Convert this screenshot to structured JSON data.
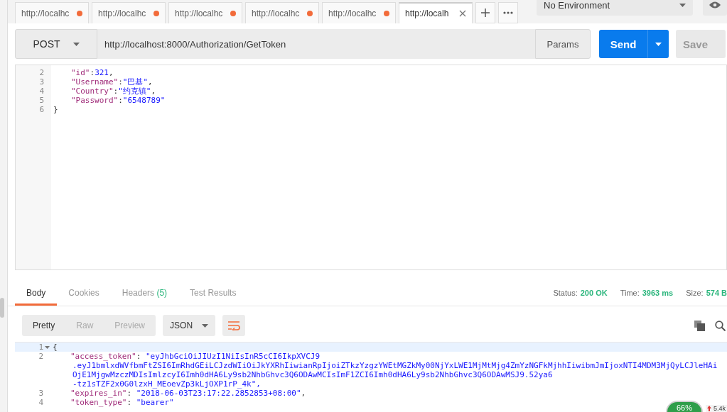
{
  "tabs": [
    {
      "label": "http://localhc",
      "selected": false,
      "unsaved": true
    },
    {
      "label": "http://localhc",
      "selected": false,
      "unsaved": true
    },
    {
      "label": "http://localhc",
      "selected": false,
      "unsaved": true
    },
    {
      "label": "http://localhc",
      "selected": false,
      "unsaved": true
    },
    {
      "label": "http://localhc",
      "selected": false,
      "unsaved": true
    },
    {
      "label": "http://localh",
      "selected": true,
      "unsaved": false
    }
  ],
  "environment": {
    "value": "No Environment"
  },
  "request": {
    "method": "POST",
    "url": "http://localhost:8000/Authorization/GetToken",
    "params_label": "Params",
    "send_label": "Send",
    "save_label": "Save"
  },
  "request_body": [
    {
      "number": "2",
      "segments": [
        {
          "kind": "key",
          "text": "\"id\""
        },
        {
          "kind": "punct",
          "text": ":"
        },
        {
          "kind": "number",
          "text": "321"
        },
        {
          "kind": "punct",
          "text": ","
        }
      ]
    },
    {
      "number": "3",
      "segments": [
        {
          "kind": "key",
          "text": "\"Username\""
        },
        {
          "kind": "punct",
          "text": ":"
        },
        {
          "kind": "string",
          "text": "\"巴基\""
        },
        {
          "kind": "punct",
          "text": ","
        }
      ]
    },
    {
      "number": "4",
      "segments": [
        {
          "kind": "key",
          "text": "\"Country\""
        },
        {
          "kind": "punct",
          "text": ":"
        },
        {
          "kind": "string",
          "text": "\"约克镇\""
        },
        {
          "kind": "punct",
          "text": ","
        }
      ]
    },
    {
      "number": "5",
      "segments": [
        {
          "kind": "key",
          "text": "\"Password\""
        },
        {
          "kind": "punct",
          "text": ":"
        },
        {
          "kind": "string",
          "text": "\"6548789\""
        }
      ]
    },
    {
      "number": "6",
      "segments": [
        {
          "kind": "punct",
          "text": "}"
        }
      ],
      "indent": false
    }
  ],
  "response_tabs": [
    {
      "label": "Body",
      "selected": true
    },
    {
      "label": "Cookies",
      "selected": false
    },
    {
      "label": "Headers",
      "count": "(5)",
      "selected": false
    },
    {
      "label": "Test Results",
      "selected": false
    }
  ],
  "status": [
    {
      "label": "Status:",
      "value": "200 OK"
    },
    {
      "label": "Time:",
      "value": "3963 ms"
    },
    {
      "label": "Size:",
      "value": "574 B"
    }
  ],
  "view_modes": [
    {
      "label": "Pretty",
      "selected": true
    },
    {
      "label": "Raw",
      "selected": false
    },
    {
      "label": "Preview",
      "selected": false
    }
  ],
  "format": {
    "value": "JSON"
  },
  "response_body": [
    {
      "number": "1",
      "foldable": true,
      "highlighted": true,
      "segments": [
        {
          "kind": "punct",
          "text": "{"
        }
      ],
      "indent": false
    },
    {
      "number": "2",
      "segments": [
        {
          "kind": "key",
          "text": "\"access_token\""
        },
        {
          "kind": "punct",
          "text": ": "
        },
        {
          "kind": "string",
          "text": "\"eyJhbGciOiJIUzI1NiIsInR5cCI6IkpXVCJ9"
        }
      ],
      "wrapped": [
        ".eyJ1bmlxdWVfbmFtZSI6ImRhdGEiLCJzdWIiOiJkYXRhIiwianRpIjoiZTkzYzgzYWEtMGZkMy00NjYxLWE1MjMtMjg4ZmYzNGFkMjhhIiwibmJmIjoxNTI4MDM3MjQyLCJleHAi",
        "OjE1MjgwMzczMDIsImlzcyI6Imh0dHA6Ly9sb2NhbGhvc3Q6ODAwMCIsImF1ZCI6Imh0dHA6Ly9sb2NhbGhvc3Q6ODAwMSJ9.52ya6",
        "-tz1sTZF2x0G0lzxH_MEoevZp3kLjOXP1rP_4k\","
      ]
    },
    {
      "number": "3",
      "segments": [
        {
          "kind": "key",
          "text": "\"expires_in\""
        },
        {
          "kind": "punct",
          "text": ": "
        },
        {
          "kind": "string",
          "text": "\"2018-06-03T23:17:22.2852853+08:00\""
        },
        {
          "kind": "punct",
          "text": ","
        }
      ]
    },
    {
      "number": "4",
      "segments": [
        {
          "kind": "key",
          "text": "\"token_type\""
        },
        {
          "kind": "punct",
          "text": ": "
        },
        {
          "kind": "string",
          "text": "\"bearer\""
        }
      ]
    }
  ],
  "widget": {
    "percent": "66%",
    "speed": "5.4k"
  }
}
